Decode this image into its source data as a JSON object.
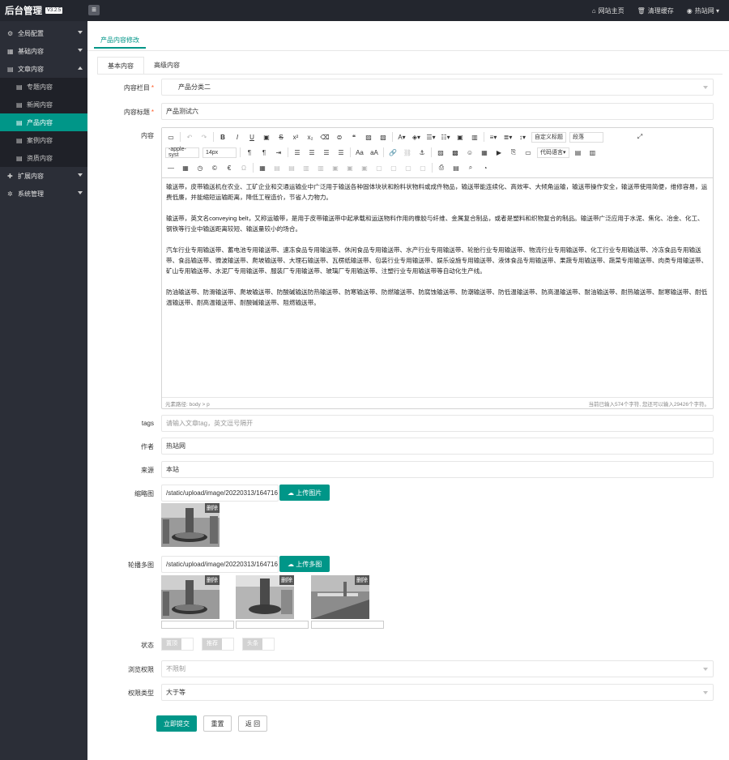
{
  "topbar": {
    "logo": "后台管理",
    "version": "V3.2.5",
    "links": [
      {
        "icon": "home-icon",
        "label": "网站主页"
      },
      {
        "icon": "trash-icon",
        "label": "清理缓存"
      },
      {
        "icon": "user-icon",
        "label": "热站网"
      }
    ]
  },
  "sidebar": {
    "items": [
      {
        "label": "全局配置",
        "icon": "gear-icon"
      },
      {
        "label": "基础内容",
        "icon": "grid-icon"
      },
      {
        "label": "文章内容",
        "icon": "file-icon"
      },
      {
        "label": "扩展内容",
        "icon": "puzzle-icon"
      },
      {
        "label": "系统管理",
        "icon": "cog-icon"
      }
    ],
    "subitems": [
      {
        "label": "专题内容"
      },
      {
        "label": "新闻内容"
      },
      {
        "label": "产品内容"
      },
      {
        "label": "案例内容"
      },
      {
        "label": "资质内容"
      }
    ]
  },
  "page": {
    "tab": "产品内容修改",
    "subtabs": [
      "基本内容",
      "高级内容"
    ]
  },
  "form": {
    "category_label": "内容栏目",
    "category_value": "产品分类二",
    "title_label": "内容标题",
    "title_value": "产品测试六",
    "content_label": "内容",
    "tags_label": "tags",
    "tags_placeholder": "请输入文章tag，英文逗号隔开",
    "author_label": "作者",
    "author_value": "热站网",
    "source_label": "来源",
    "source_value": "本站",
    "thumb_label": "缩略图",
    "thumb_value": "/static/upload/image/20220313/164716",
    "thumb_btn": "上传图片",
    "gallery_label": "轮播多图",
    "gallery_value": "/static/upload/image/20220313/164716",
    "gallery_btn": "上传多图",
    "delete_label": "删除",
    "status_label": "状态",
    "switches": [
      "置顶",
      "推荐",
      "头条"
    ],
    "access_label": "浏览权限",
    "access_value": "不限制",
    "perm_type_label": "权限类型",
    "perm_type_value": "大于等",
    "submit": "立即提交",
    "reset": "重置",
    "back": "返 回"
  },
  "editor": {
    "font_family": "-apple-syst",
    "font_size": "14px",
    "custom_title": "自定义标题",
    "paragraph": "段落",
    "code_lang": "代码语言",
    "paragraphs": [
      "输送带，皮带输送机在农业、工矿企业和交通运输业中广泛用于输送各种固体块状和粉料状物料或成件物品，输送带能连续化、高效率、大倾角运输，输送带操作安全，输送带使用简便，维修容易，运费低廉，并能缩短运输距离，降低工程造价，节省人力物力。",
      "输送带，英文名conveying belt，又称运输带，是用于皮带输送带中起承载和运送物料作用的橡胶与纤维、金属复合制品，或者是塑料和织物复合的制品。输送带广泛应用于水泥、焦化、冶金、化工、钢铁等行业中输送距离较短、输送量较小的场合。",
      "汽车行业专用输送带、蓄电池专用输送带、速冻食品专用输送带、休闲食品专用输送带、水产行业专用输送带、轮胎行业专用输送带、物流行业专用输送带、化工行业专用输送带、冷冻食品专用输送带、食品输送带、微波输送带、爬坡输送带、大理石输送带、瓦楞纸输送带、包装行业专用输送带、娱乐设施专用输送带、液体食品专用输送带、果蔬专用输送带、蔬菜专用输送带、肉类专用输送带、矿山专用输送带、水泥厂专用输送带、服装厂专用输送带、玻璃厂专用输送带、注塑行业专用输送带等自动化生产线。",
      "防油输送带、防滑输送带、爬坡输送带、防酸碱输送防热输送带、防寒输送带、防燃输送带、防腐蚀输送带、防潮输送带、防低温输送带、防高温输送带、耐油输送带、耐热输送带、耐寒输送带、耐低温输送带、耐高温输送带、耐酸碱输送带、阻燃输送带。"
    ],
    "path": "元素路径: body > p",
    "count": "当前已输入574个字符, 您还可以输入29426个字符。"
  }
}
